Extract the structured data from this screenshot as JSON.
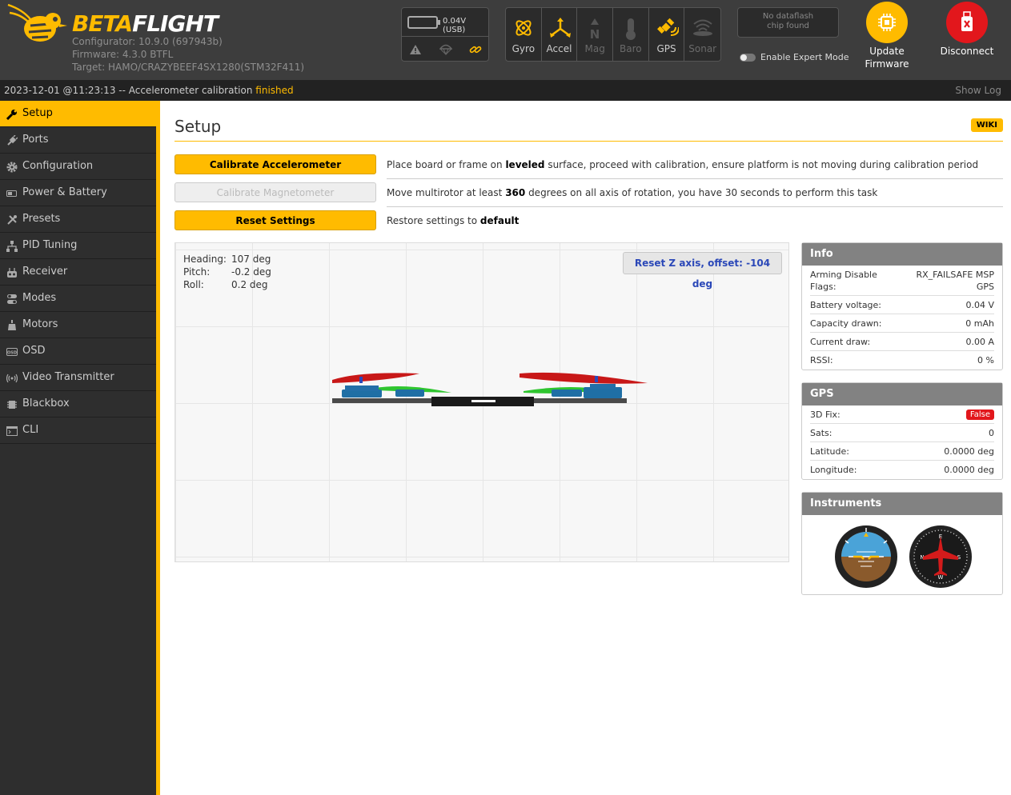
{
  "header": {
    "logo_text_a": "BETA",
    "logo_text_b": "FLIGHT",
    "configurator": "Configurator: 10.9.0 (697943b)",
    "firmware": "Firmware: 4.3.0 BTFL",
    "target": "Target: HAMO/CRAZYBEEF4SX1280(STM32F411)",
    "battery_text": "0.04V (USB)",
    "sensors": [
      {
        "label": "Gyro",
        "icon": "gyro-icon",
        "active": true
      },
      {
        "label": "Accel",
        "icon": "accel-icon",
        "active": true
      },
      {
        "label": "Mag",
        "icon": "mag-icon",
        "active": false
      },
      {
        "label": "Baro",
        "icon": "baro-icon",
        "active": false
      },
      {
        "label": "GPS",
        "icon": "gps-icon",
        "active": true
      },
      {
        "label": "Sonar",
        "icon": "sonar-icon",
        "active": false
      }
    ],
    "dataflash_line1": "No dataflash",
    "dataflash_line2": "chip found",
    "expert_mode_label": "Enable Expert Mode",
    "update_firmware_line1": "Update",
    "update_firmware_line2": "Firmware",
    "disconnect_label": "Disconnect"
  },
  "status": {
    "message": "2023-12-01 @11:23:13 -- Accelerometer calibration ",
    "result": "finished",
    "show_log": "Show Log"
  },
  "sidebar": {
    "items": [
      {
        "label": "Setup",
        "icon": "wrench-icon"
      },
      {
        "label": "Ports",
        "icon": "plug-icon"
      },
      {
        "label": "Configuration",
        "icon": "gear-icon"
      },
      {
        "label": "Power & Battery",
        "icon": "battery-icon"
      },
      {
        "label": "Presets",
        "icon": "tools-icon"
      },
      {
        "label": "PID Tuning",
        "icon": "pid-icon"
      },
      {
        "label": "Receiver",
        "icon": "receiver-icon"
      },
      {
        "label": "Modes",
        "icon": "modes-icon"
      },
      {
        "label": "Motors",
        "icon": "motor-icon"
      },
      {
        "label": "OSD",
        "icon": "osd-icon"
      },
      {
        "label": "Video Transmitter",
        "icon": "vtx-icon"
      },
      {
        "label": "Blackbox",
        "icon": "blackbox-icon"
      },
      {
        "label": "CLI",
        "icon": "cli-icon"
      }
    ]
  },
  "main": {
    "title": "Setup",
    "wiki": "WIKI",
    "calibrate_accel": {
      "button": "Calibrate Accelerometer",
      "pre": "Place board or frame on ",
      "bold": "leveled",
      "post": " surface, proceed with calibration, ensure platform is not moving during calibration period"
    },
    "calibrate_mag": {
      "button": "Calibrate Magnetometer",
      "pre": "Move multirotor at least ",
      "bold": "360",
      "post": " degrees on all axis of rotation, you have 30 seconds to perform this task"
    },
    "reset": {
      "button": "Reset Settings",
      "pre": "Restore settings to ",
      "bold": "default"
    },
    "attitude": {
      "heading_label": "Heading:",
      "heading": "107 deg",
      "pitch_label": "Pitch:",
      "pitch": "-0.2 deg",
      "roll_label": "Roll:",
      "roll": "0.2 deg"
    },
    "reset_z": "Reset Z axis, offset: -104 deg"
  },
  "info": {
    "title": "Info",
    "arming_label": "Arming Disable Flags:",
    "arming_value": "RX_FAILSAFE  MSP GPS",
    "battery_label": "Battery voltage:",
    "battery_value": "0.04 V",
    "capacity_label": "Capacity drawn:",
    "capacity_value": "0 mAh",
    "current_label": "Current draw:",
    "current_value": "0.00 A",
    "rssi_label": "RSSI:",
    "rssi_value": "0 %"
  },
  "gps": {
    "title": "GPS",
    "fix_label": "3D Fix:",
    "fix_value": "False",
    "sats_label": "Sats:",
    "sats_value": "0",
    "lat_label": "Latitude:",
    "lat_value": "0.0000 deg",
    "lon_label": "Longitude:",
    "lon_value": "0.0000 deg"
  },
  "instruments": {
    "title": "Instruments"
  },
  "colors": {
    "accent": "#ffbb00",
    "disconnect": "#e2171c",
    "header": "#3d3d3d",
    "sidebar": "#2e2e2e"
  }
}
